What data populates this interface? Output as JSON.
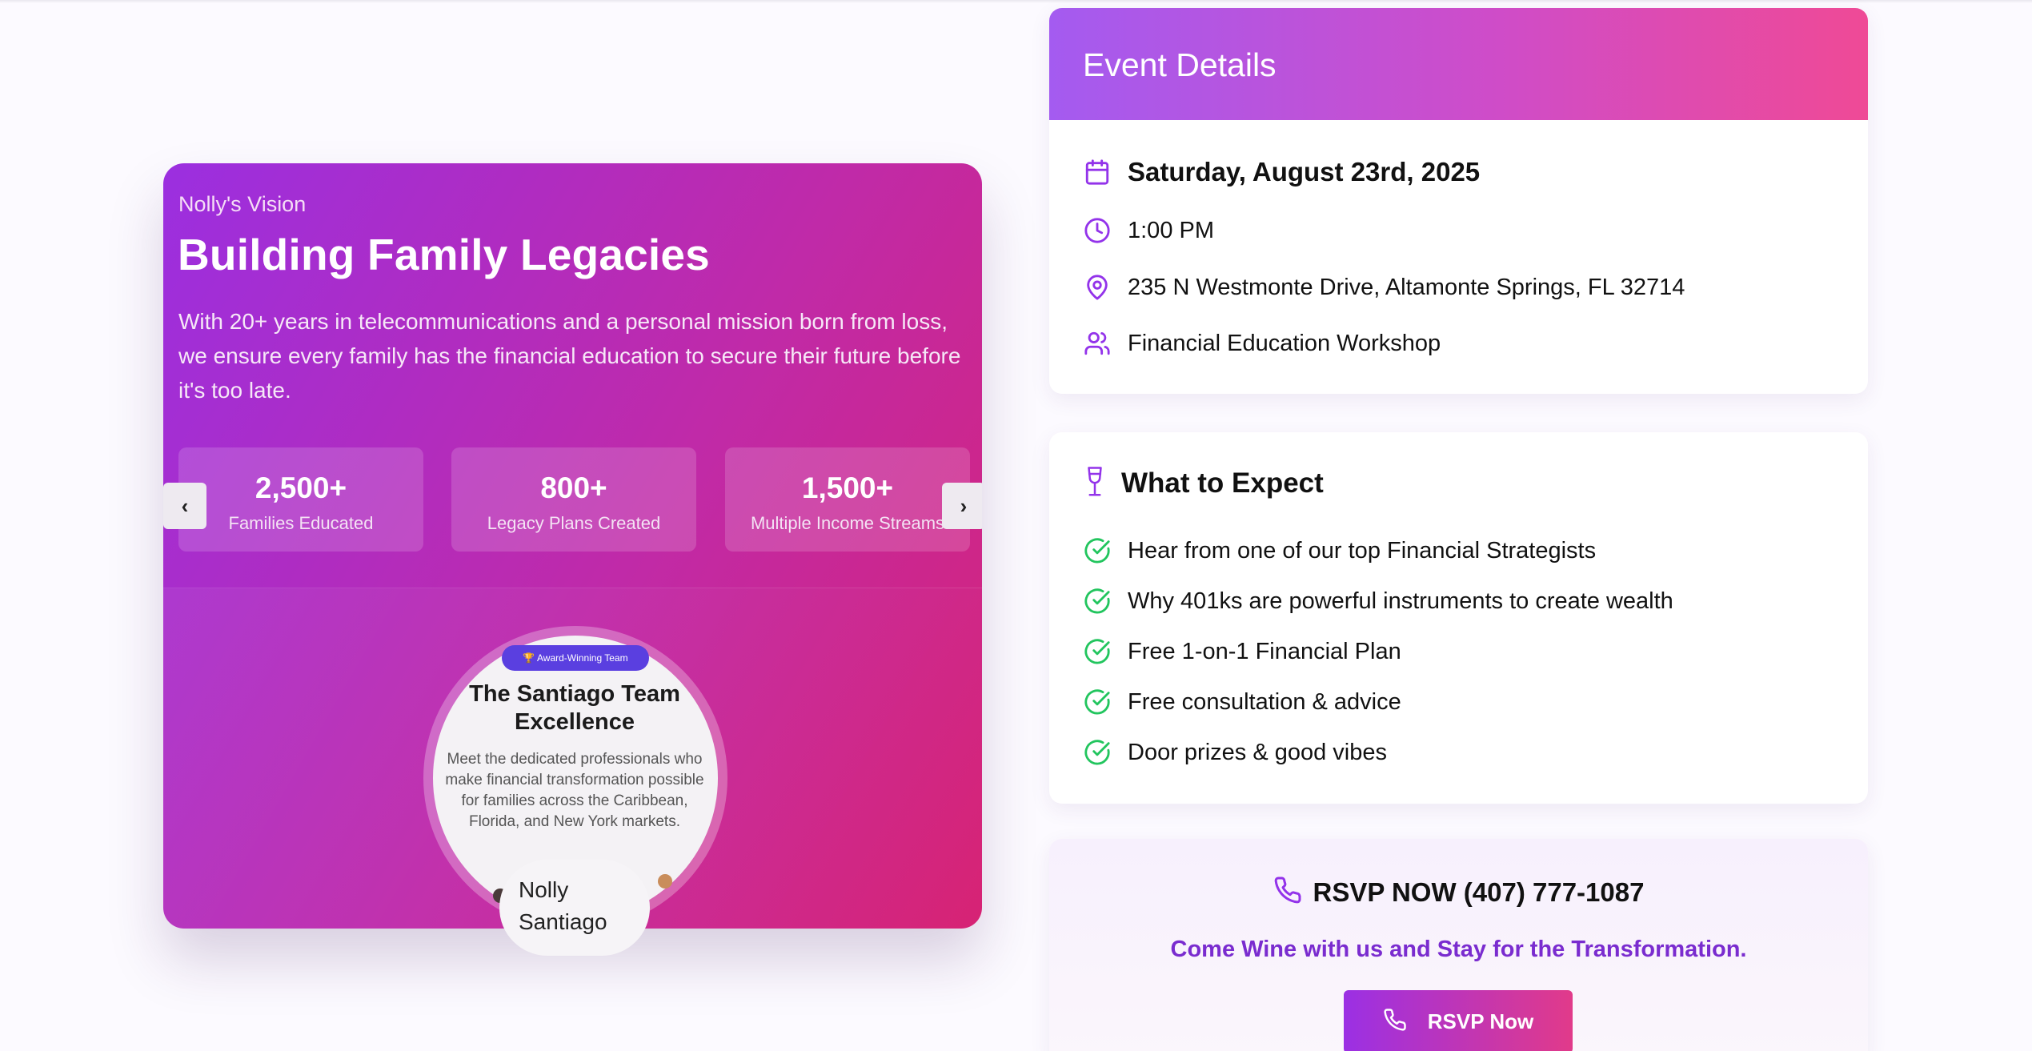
{
  "hero": {
    "eyebrow": "Nolly's Vision",
    "title": "Building Family Legacies",
    "description": "With 20+ years in telecommunications and a personal mission born from loss, we ensure every family has the financial education to secure their future before it's too late.",
    "stats": [
      {
        "value": "2,500+",
        "label": "Families Educated"
      },
      {
        "value": "800+",
        "label": "Legacy Plans Created"
      },
      {
        "value": "1,500+",
        "label": "Multiple Income Streams"
      }
    ],
    "prev_icon": "‹",
    "next_icon": "›",
    "slide": {
      "badge": "🏆 Award-Winning Team",
      "title": "The Santiago Team Excellence",
      "description": "Meet the dedicated professionals who make financial transformation possible for families across the Caribbean, Florida, and New York markets.",
      "name": "Nolly Santiago"
    }
  },
  "event": {
    "title": "Event Details",
    "date": "Saturday, August 23rd, 2025",
    "time": "1:00 PM",
    "address": "235 N Westmonte Drive, Altamonte Springs, FL 32714",
    "type": "Financial Education Workshop",
    "icon_color": "#9333ea"
  },
  "expect": {
    "title": "What to Expect",
    "items": [
      "Hear from one of our top Financial Strategists",
      "Why 401ks are powerful instruments to create wealth",
      "Free 1-on-1 Financial Plan",
      "Free consultation & advice",
      "Door prizes & good vibes"
    ],
    "check_color": "#22c55e"
  },
  "rsvp": {
    "headline": "RSVP NOW (407) 777-1087",
    "tagline": "Come Wine with us and Stay for the Transformation.",
    "button_label": "RSVP Now"
  }
}
